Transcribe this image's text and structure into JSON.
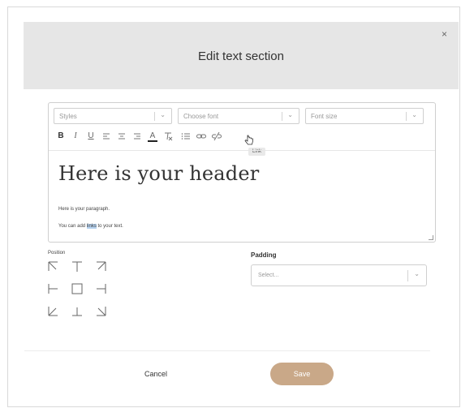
{
  "modal": {
    "title": "Edit text section",
    "close_glyph": "×"
  },
  "toolbar": {
    "styles_placeholder": "Styles",
    "font_placeholder": "Choose font",
    "size_placeholder": "Font size",
    "bold": "B",
    "italic": "I",
    "underline": "U",
    "text_color": "A",
    "tooltip": "Link"
  },
  "content": {
    "header": "Here is your header",
    "paragraph": "Here is your paragraph.",
    "link_before": "You can add ",
    "link_word": "links",
    "link_after": " to your text."
  },
  "position": {
    "label": "Position"
  },
  "padding": {
    "label": "Padding",
    "placeholder": "Select..."
  },
  "footer": {
    "cancel": "Cancel",
    "save": "Save"
  },
  "colors": {
    "header_bg": "#e6e6e6",
    "save_bg": "#c9a888",
    "selection": "#b6d2ef"
  }
}
